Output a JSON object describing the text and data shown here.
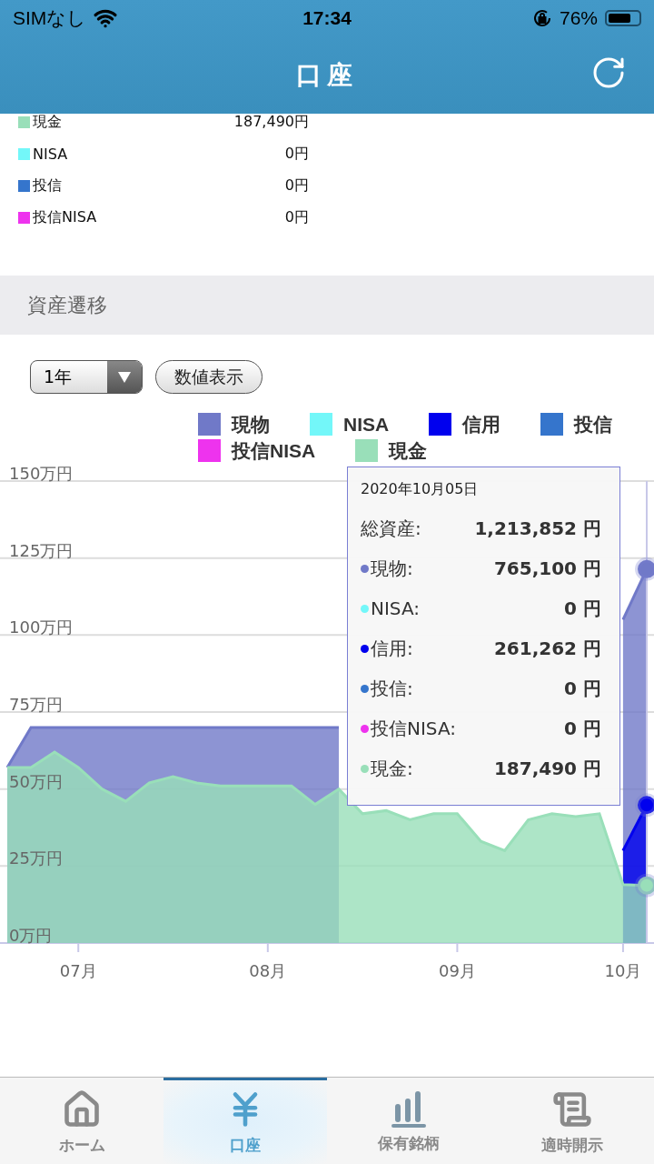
{
  "status_bar": {
    "carrier": "SIMなし",
    "time": "17:34",
    "battery": "76%"
  },
  "header": {
    "title": "口座"
  },
  "balances": [
    {
      "label": "現金",
      "value": "187,490円",
      "color": "#99dfb9"
    },
    {
      "label": "NISA",
      "value": "0円",
      "color": "#73f7f9"
    },
    {
      "label": "投信",
      "value": "0円",
      "color": "#3575cc"
    },
    {
      "label": "投信NISA",
      "value": "0円",
      "color": "#ee33ee"
    }
  ],
  "section": {
    "title": "資産遷移"
  },
  "period_select": {
    "value": "1年"
  },
  "value_button": {
    "label": "数値表示"
  },
  "chart_data": {
    "type": "area",
    "stacked": false,
    "grid": true,
    "ylim": [
      0,
      150
    ],
    "categories": [
      null,
      null,
      null,
      "07月",
      null,
      null,
      null,
      null,
      null,
      null,
      null,
      "08月",
      null,
      null,
      null,
      null,
      null,
      null,
      null,
      "09月",
      null,
      null,
      null,
      null,
      null,
      null,
      "10月",
      null
    ],
    "yticks": [
      {
        "value": 0,
        "label": "0万円"
      },
      {
        "value": 25,
        "label": "25万円"
      },
      {
        "value": 50,
        "label": "50万円"
      },
      {
        "value": 75,
        "label": "75万円"
      },
      {
        "value": 100,
        "label": "100万円"
      },
      {
        "value": 125,
        "label": "125万円"
      },
      {
        "value": 150,
        "label": "150万円"
      }
    ],
    "series": [
      {
        "name": "現物",
        "color": "#7079c8",
        "values": [
          57,
          70,
          70,
          70,
          70,
          70,
          70,
          70,
          70,
          70,
          70,
          70,
          70,
          70,
          70,
          null,
          null,
          null,
          null,
          null,
          null,
          null,
          null,
          null,
          null,
          null,
          105,
          121.4
        ]
      },
      {
        "name": "NISA",
        "color": "#73f7f9",
        "values": [
          null,
          null,
          null,
          null,
          null,
          null,
          null,
          null,
          null,
          null,
          null,
          null,
          null,
          null,
          null,
          null,
          null,
          null,
          null,
          null,
          null,
          null,
          null,
          null,
          null,
          null,
          null,
          null
        ]
      },
      {
        "name": "信用",
        "color": "#0000ee",
        "values": [
          null,
          null,
          null,
          null,
          null,
          null,
          null,
          null,
          null,
          null,
          null,
          null,
          null,
          null,
          null,
          null,
          null,
          null,
          null,
          null,
          null,
          null,
          null,
          null,
          null,
          null,
          30,
          44.8
        ]
      },
      {
        "name": "投信",
        "color": "#3575cc",
        "values": [
          null,
          null,
          null,
          null,
          null,
          null,
          null,
          null,
          null,
          null,
          null,
          null,
          null,
          null,
          null,
          null,
          null,
          null,
          null,
          null,
          null,
          null,
          null,
          null,
          null,
          null,
          null,
          null
        ]
      },
      {
        "name": "投信NISA",
        "color": "#ee33ee",
        "values": [
          null,
          null,
          null,
          null,
          null,
          null,
          null,
          null,
          null,
          null,
          null,
          null,
          null,
          null,
          null,
          null,
          null,
          null,
          null,
          null,
          null,
          null,
          null,
          null,
          null,
          null,
          null,
          null
        ]
      },
      {
        "name": "現金",
        "color": "#99dfb9",
        "values": [
          57,
          57,
          62,
          57,
          50,
          46,
          52,
          54,
          52,
          51,
          51,
          51,
          51,
          45,
          50,
          42,
          43,
          40,
          42,
          42,
          33,
          30,
          40,
          42,
          41,
          42,
          19,
          18.7
        ]
      }
    ]
  },
  "tooltip": {
    "date": "2020年10月05日",
    "total": {
      "label": "総資産:",
      "value": "1,213,852 円"
    },
    "rows": [
      {
        "label": "現物:",
        "value": "765,100 円",
        "color": "#7079c8"
      },
      {
        "label": "NISA:",
        "value": "0 円",
        "color": "#73f7f9"
      },
      {
        "label": "信用:",
        "value": "261,262 円",
        "color": "#0000ee"
      },
      {
        "label": "投信:",
        "value": "0 円",
        "color": "#3575cc"
      },
      {
        "label": "投信NISA:",
        "value": "0 円",
        "color": "#ee33ee"
      },
      {
        "label": "現金:",
        "value": "187,490 円",
        "color": "#99dfb9"
      }
    ]
  },
  "tab_bar": [
    {
      "label": "ホーム",
      "selected": false
    },
    {
      "label": "口座",
      "selected": true
    },
    {
      "label": "保有銘柄",
      "selected": false
    },
    {
      "label": "適時開示",
      "selected": false
    }
  ]
}
